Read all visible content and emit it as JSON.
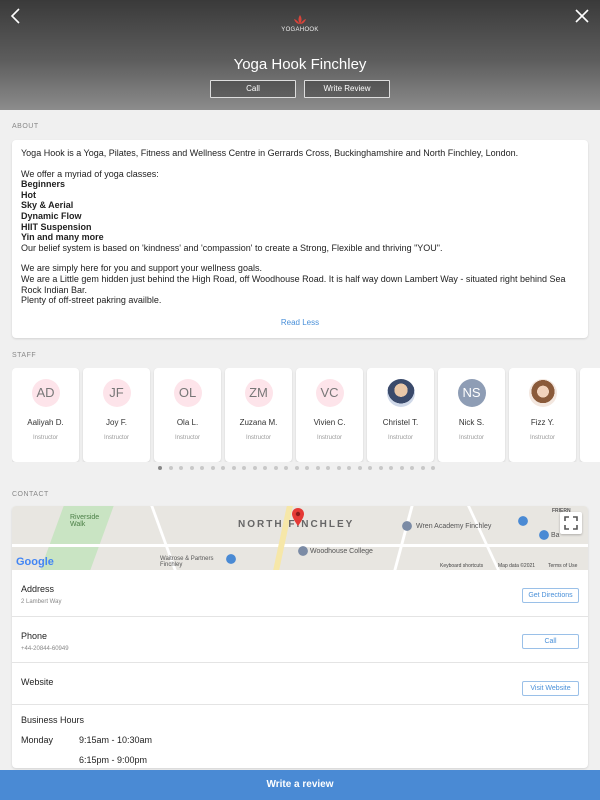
{
  "header": {
    "logo_text": "YOGAHOOK",
    "title": "Yoga Hook Finchley",
    "call_label": "Call",
    "write_review_label": "Write Review"
  },
  "sections": {
    "about": "ABOUT",
    "staff": "STAFF",
    "contact": "CONTACT"
  },
  "about": {
    "intro": "Yoga Hook is a Yoga, Pilates, Fitness and Wellness Centre in Gerrards Cross, Buckinghamshire and North Finchley, London.",
    "classes_intro": "We offer a myriad of yoga classes:",
    "classes": [
      "Beginners",
      "Hot",
      "Sky & Aerial",
      "Dynamic Flow",
      "HIIT Suspension",
      "Yin and many more"
    ],
    "belief": "Our belief system is based on 'kindness' and 'compassion' to create a Strong, Flexible and thriving \"YOU\".",
    "support": "We are simply here for you and support your wellness goals.",
    "location": "We are a Little gem hidden just behind the High Road, off Woodhouse Road. It is half way down Lambert Way - situated right behind Sea Rock Indian Bar.",
    "parking": "Plenty of off-street pakring availble.",
    "read_less": "Read Less"
  },
  "staff": [
    {
      "initials": "AD",
      "name": "Aaliyah D.",
      "role": "Instructor"
    },
    {
      "initials": "JF",
      "name": "Joy F.",
      "role": "Instructor"
    },
    {
      "initials": "OL",
      "name": "Ola L.",
      "role": "Instructor"
    },
    {
      "initials": "ZM",
      "name": "Zuzana M.",
      "role": "Instructor"
    },
    {
      "initials": "VC",
      "name": "Vivien C.",
      "role": "Instructor"
    },
    {
      "initials": "",
      "name": "Christel T.",
      "role": "Instructor"
    },
    {
      "initials": "NS",
      "name": "Nick S.",
      "role": "Instructor"
    },
    {
      "initials": "",
      "name": "Fizz Y.",
      "role": "Instructor"
    }
  ],
  "pagination": {
    "total_dots": 27,
    "active_index": 0
  },
  "map": {
    "area": "NORTH FINCHLEY",
    "place_riverside": "Riverside Walk",
    "place_wren": "Wren Academy Finchley",
    "place_woodhouse": "Woodhouse College",
    "place_waitrose": "Waitrose & Partners Finchley",
    "place_friern": "FRIERN",
    "place_ba": "Ba",
    "keyboard": "Keyboard shortcuts",
    "mapdata": "Map data ©2021",
    "terms": "Terms of Use",
    "google": "Google"
  },
  "contact": {
    "address_label": "Address",
    "address_value": "2 Lambert Way",
    "directions_btn": "Get Directions",
    "phone_label": "Phone",
    "phone_value": "+44-20844-60949",
    "call_btn": "Call",
    "website_label": "Website",
    "website_btn": "Visit Website",
    "hours_label": "Business Hours",
    "hours_day": "Monday",
    "hours_1": "9:15am - 10:30am",
    "hours_2": "6:15pm - 9:00pm"
  },
  "bottom_bar": "Write a review"
}
